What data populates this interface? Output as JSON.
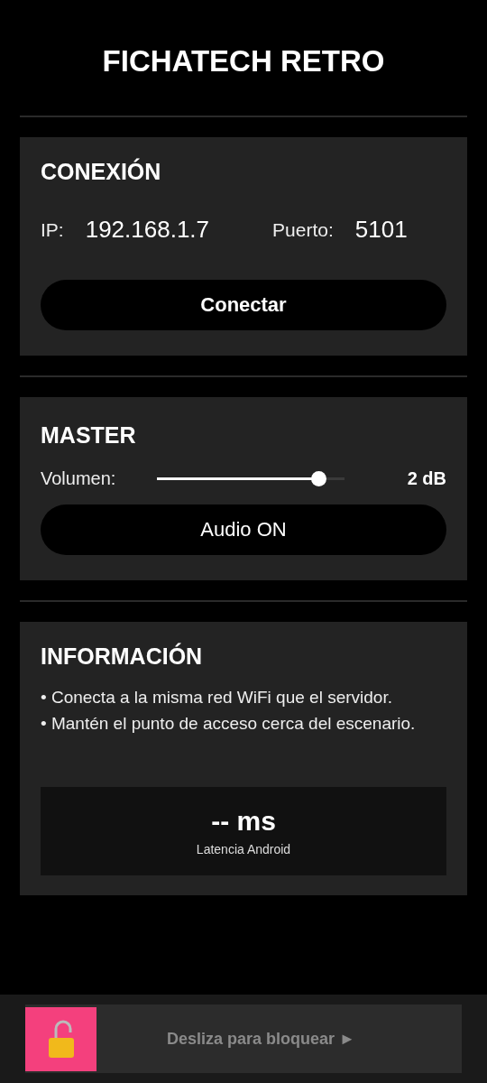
{
  "title": "FICHATECH RETRO",
  "connection": {
    "heading": "CONEXIÓN",
    "ip_label": "IP:",
    "ip_value": "192.168.1.7",
    "port_label": "Puerto:",
    "port_value": "5101",
    "button": "Conectar"
  },
  "master": {
    "heading": "MASTER",
    "volume_label": "Volumen:",
    "level": 0.86,
    "reading": "2 dB",
    "button": "Audio ON"
  },
  "info": {
    "heading": "INFORMACIÓN",
    "bullets": [
      "• Conecta a la misma red WiFi que el servidor.",
      "• Mantén el punto de acceso cerca del escenario."
    ],
    "latency_value": "-- ms",
    "latency_label": "Latencia Android"
  },
  "lock_slider": {
    "label": "Desliza para bloquear ►",
    "locked": false
  }
}
